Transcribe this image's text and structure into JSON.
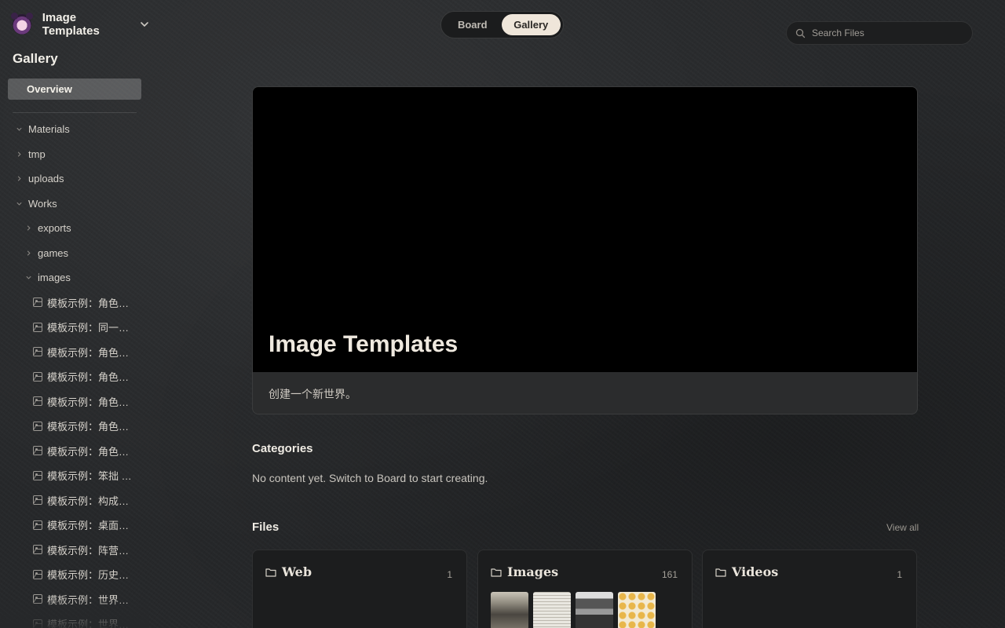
{
  "workspace": {
    "title": "Image Templates"
  },
  "sidebar": {
    "section_title": "Gallery",
    "overview_label": "Overview",
    "tree": [
      {
        "label": "Materials",
        "indent": 0,
        "kind": "folder",
        "expanded": true
      },
      {
        "label": "tmp",
        "indent": 0,
        "kind": "folder",
        "expanded": false
      },
      {
        "label": "uploads",
        "indent": 0,
        "kind": "folder",
        "expanded": false
      },
      {
        "label": "Works",
        "indent": 0,
        "kind": "folder",
        "expanded": true
      },
      {
        "label": "exports",
        "indent": 1,
        "kind": "folder",
        "expanded": false
      },
      {
        "label": "games",
        "indent": 1,
        "kind": "folder",
        "expanded": false
      },
      {
        "label": "images",
        "indent": 1,
        "kind": "folder",
        "expanded": true
      },
      {
        "label": "模板示例：角色生…",
        "indent": 2,
        "kind": "image"
      },
      {
        "label": "模板示例：同一角…",
        "indent": 2,
        "kind": "image"
      },
      {
        "label": "模板示例：角色设…",
        "indent": 2,
        "kind": "image"
      },
      {
        "label": "模板示例：角色等…",
        "indent": 2,
        "kind": "image"
      },
      {
        "label": "模板示例：角色毛…",
        "indent": 2,
        "kind": "image"
      },
      {
        "label": "模板示例：角色档…",
        "indent": 2,
        "kind": "image"
      },
      {
        "label": "模板示例：角色语…",
        "indent": 2,
        "kind": "image"
      },
      {
        "label": "模板示例：笨拙 …",
        "indent": 2,
        "kind": "image"
      },
      {
        "label": "模板示例：构成主…",
        "indent": 2,
        "kind": "image"
      },
      {
        "label": "模板示例：桌面吉…",
        "indent": 2,
        "kind": "image"
      },
      {
        "label": "模板示例：阵营徽…",
        "indent": 2,
        "kind": "image"
      },
      {
        "label": "模板示例：历史报…",
        "indent": 2,
        "kind": "image"
      },
      {
        "label": "模板示例：世界内…",
        "indent": 2,
        "kind": "image"
      },
      {
        "label": "模板示例：世界内…",
        "indent": 2,
        "kind": "image"
      }
    ]
  },
  "view_switch": {
    "board": "Board",
    "gallery": "Gallery",
    "active": "gallery"
  },
  "search": {
    "placeholder": "Search Files",
    "value": ""
  },
  "hero": {
    "title": "Image Templates",
    "description": "创建一个新世界。"
  },
  "categories": {
    "title": "Categories",
    "empty_text": "No content yet. Switch to Board to start creating."
  },
  "files": {
    "title": "Files",
    "view_all": "View all",
    "cards": [
      {
        "name": "Web",
        "count": "1"
      },
      {
        "name": "Images",
        "count": "161"
      },
      {
        "name": "Videos",
        "count": "1"
      }
    ]
  },
  "icons": {
    "workspace": "workspace-avatar-icon",
    "dropdown": "chevron-down-icon",
    "search": "search-icon",
    "folder": "folder-icon",
    "image": "image-icon"
  },
  "colors": {
    "accent": "#efe6da",
    "background": "#26282a",
    "card": "#1c1d1e"
  }
}
